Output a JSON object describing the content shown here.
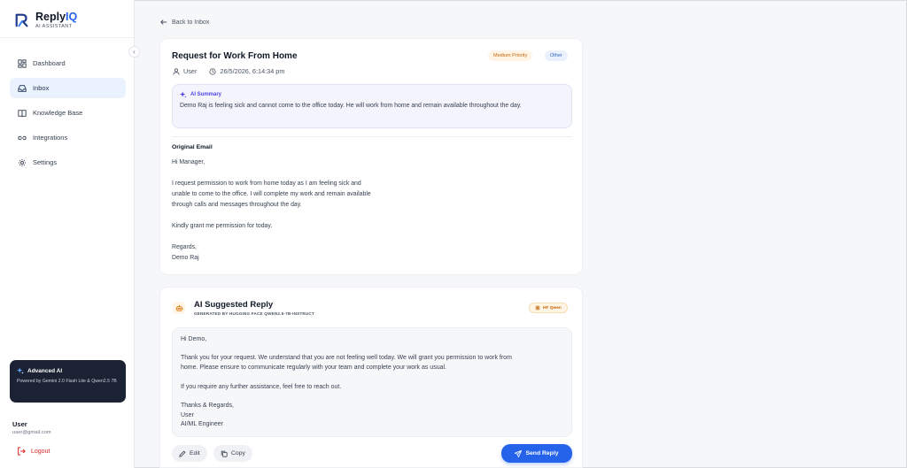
{
  "brand": {
    "name_main": "Reply",
    "name_accent": "IQ",
    "subtitle": "AI ASSISTANT",
    "accent_color": "#2563eb"
  },
  "sidebar": {
    "items": [
      {
        "label": "Dashboard",
        "icon": "dashboard-icon",
        "active": false
      },
      {
        "label": "Inbox",
        "icon": "inbox-icon",
        "active": true
      },
      {
        "label": "Knowledge Base",
        "icon": "book-icon",
        "active": false
      },
      {
        "label": "Integrations",
        "icon": "link-icon",
        "active": false
      },
      {
        "label": "Settings",
        "icon": "gear-icon",
        "active": false
      }
    ],
    "promo": {
      "title": "Advanced AI",
      "description": "Powered by Gemini 2.0 Flash Lite & Qwen2.5 7B"
    },
    "user": {
      "name": "User",
      "email": "user@gmail.com"
    },
    "logout_label": "Logout"
  },
  "main": {
    "back_label": "Back to Inbox",
    "email": {
      "subject": "Request for Work From Home",
      "priority_badge": "Medium Priority",
      "category_badge": "Other",
      "sender": "User",
      "timestamp": "26/5/2026, 6:14:34 pm",
      "summary_title": "AI Summary",
      "summary_text": "Demo Raj is feeling sick and cannot come to the office today. He will work from home and remain available throughout the day.",
      "original_label": "Original Email",
      "body": "Hi Manager,\n\nI request permission to work from home today as I am feeling sick and\nunable to come to the office. I will complete my work and remain available\nthrough calls and messages throughout the day.\n\nKindly grant me permission for today.\n\nRegards,\nDemo Raj"
    },
    "reply": {
      "title": "AI Suggested Reply",
      "subtitle": "GENERATED BY HUGGING FACE QWEN2.5-7B-INSTRUCT",
      "model_badge": "HF Qwen",
      "body": "Hi Demo,\n\nThank you for your request. We understand that you are not feeling well today. We will grant you permission to work from\nhome. Please ensure to communicate regularly with your team and complete your work as usual.\n\nIf you require any further assistance, feel free to reach out.\n\nThanks & Regards,\nUser\nAI/ML Engineer",
      "edit_label": "Edit",
      "copy_label": "Copy",
      "send_label": "Send Reply"
    }
  }
}
